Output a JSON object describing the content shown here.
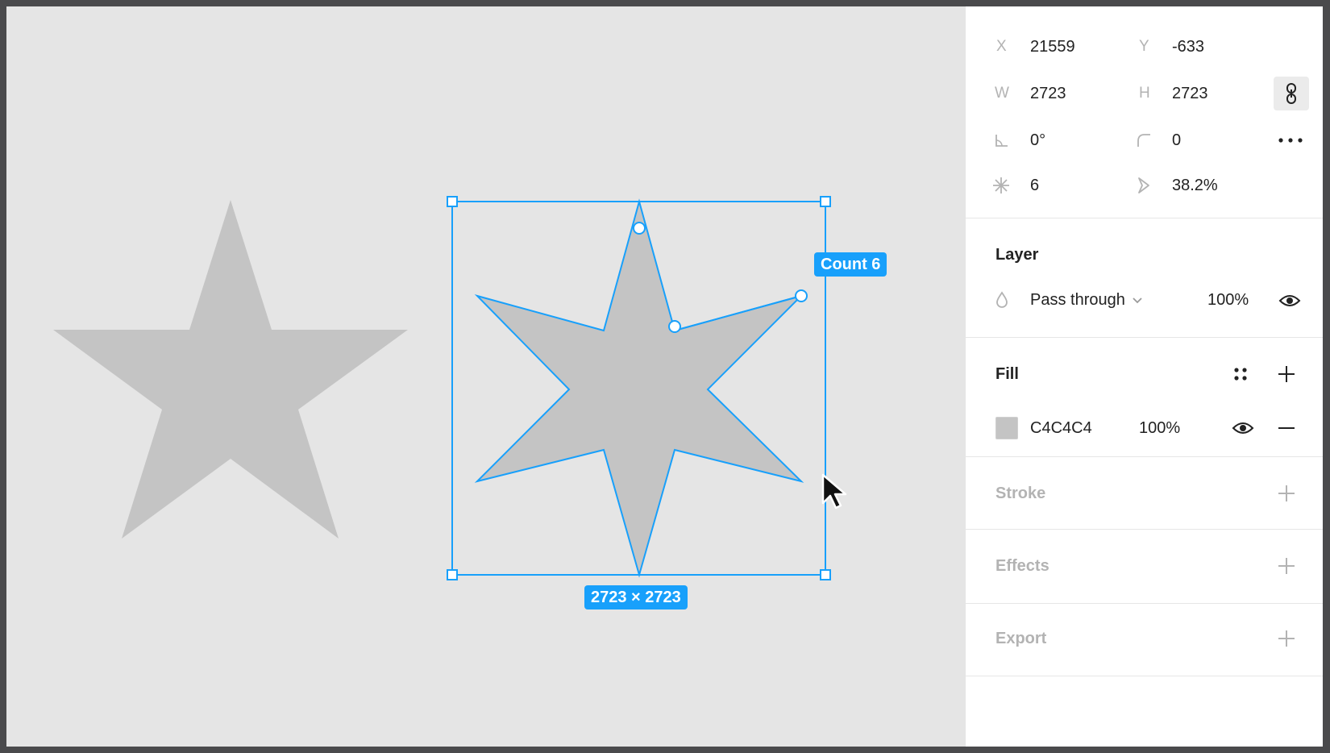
{
  "canvas": {
    "selection_size_label": "2723 × 2723",
    "count_badge": "Count 6",
    "selection_color": "#18a0fb",
    "shape_fill": "#c4c4c4"
  },
  "properties": {
    "x": {
      "label": "X",
      "value": "21559"
    },
    "y": {
      "label": "Y",
      "value": "-633"
    },
    "w": {
      "label": "W",
      "value": "2723"
    },
    "h": {
      "label": "H",
      "value": "2723"
    },
    "rotation": {
      "icon": "angle-icon",
      "value": "0°"
    },
    "corner_radius": {
      "icon": "corner-radius-icon",
      "value": "0"
    },
    "point_count": {
      "icon": "star-points-icon",
      "value": "6"
    },
    "ratio": {
      "icon": "ratio-icon",
      "value": "38.2%"
    }
  },
  "layer": {
    "title": "Layer",
    "blend_mode": "Pass through",
    "opacity": "100%"
  },
  "fill": {
    "title": "Fill",
    "color_hex": "C4C4C4",
    "opacity": "100%"
  },
  "stroke": {
    "title": "Stroke"
  },
  "effects": {
    "title": "Effects"
  },
  "export": {
    "title": "Export"
  }
}
